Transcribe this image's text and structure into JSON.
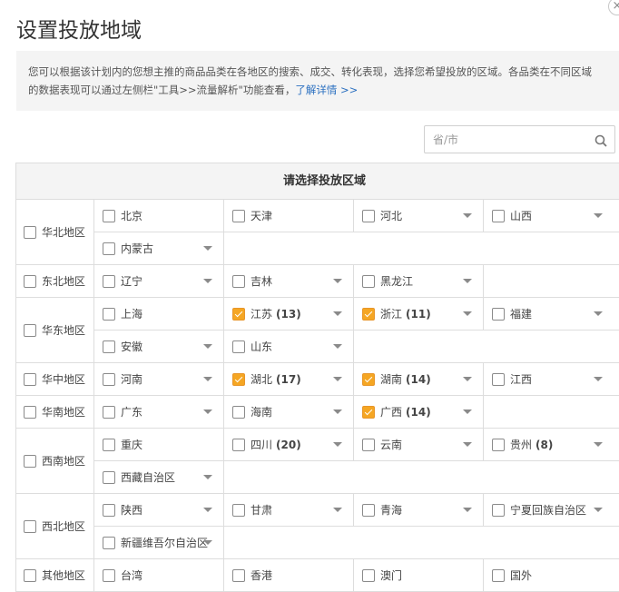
{
  "dialog": {
    "title": "设置投放地域",
    "close": "×",
    "notice_line1": "您可以根据该计划内的您想主推的商品品类在各地区的搜索、成交、转化表现，选择您希望投放的区域。各品类在不同区域",
    "notice_line2": "的数据表现可以通过左侧栏\"工具>>流量解析\"功能查看，",
    "notice_link": "了解详情 >>"
  },
  "search": {
    "placeholder": "省/市"
  },
  "table": {
    "header": "请选择投放区域",
    "regions": [
      {
        "name": "华北地区",
        "checked": false,
        "rows": [
          [
            {
              "name": "北京",
              "checked": false,
              "dropdown": false
            },
            {
              "name": "天津",
              "checked": false,
              "dropdown": false
            },
            {
              "name": "河北",
              "checked": false,
              "dropdown": true
            },
            {
              "name": "山西",
              "checked": false,
              "dropdown": true
            }
          ],
          [
            {
              "name": "内蒙古",
              "checked": false,
              "dropdown": true
            }
          ]
        ]
      },
      {
        "name": "东北地区",
        "checked": false,
        "rows": [
          [
            {
              "name": "辽宁",
              "checked": false,
              "dropdown": true
            },
            {
              "name": "吉林",
              "checked": false,
              "dropdown": true
            },
            {
              "name": "黑龙江",
              "checked": false,
              "dropdown": true
            }
          ]
        ]
      },
      {
        "name": "华东地区",
        "checked": false,
        "rows": [
          [
            {
              "name": "上海",
              "checked": false,
              "dropdown": false
            },
            {
              "name": "江苏",
              "count": "(13)",
              "checked": true,
              "dropdown": true
            },
            {
              "name": "浙江",
              "count": "(11)",
              "checked": true,
              "dropdown": true
            },
            {
              "name": "福建",
              "checked": false,
              "dropdown": true
            }
          ],
          [
            {
              "name": "安徽",
              "checked": false,
              "dropdown": true
            },
            {
              "name": "山东",
              "checked": false,
              "dropdown": true
            }
          ]
        ]
      },
      {
        "name": "华中地区",
        "checked": false,
        "rows": [
          [
            {
              "name": "河南",
              "checked": false,
              "dropdown": true
            },
            {
              "name": "湖北",
              "count": "(17)",
              "checked": true,
              "dropdown": true
            },
            {
              "name": "湖南",
              "count": "(14)",
              "checked": true,
              "dropdown": true
            },
            {
              "name": "江西",
              "checked": false,
              "dropdown": true
            }
          ]
        ]
      },
      {
        "name": "华南地区",
        "checked": false,
        "rows": [
          [
            {
              "name": "广东",
              "checked": false,
              "dropdown": true
            },
            {
              "name": "海南",
              "checked": false,
              "dropdown": true
            },
            {
              "name": "广西",
              "count": "(14)",
              "checked": true,
              "dropdown": true
            }
          ]
        ]
      },
      {
        "name": "西南地区",
        "checked": false,
        "rows": [
          [
            {
              "name": "重庆",
              "checked": false,
              "dropdown": false
            },
            {
              "name": "四川",
              "count": "(20)",
              "checked": false,
              "dropdown": true
            },
            {
              "name": "云南",
              "checked": false,
              "dropdown": true
            },
            {
              "name": "贵州",
              "count": "(8)",
              "checked": false,
              "dropdown": true
            }
          ],
          [
            {
              "name": "西藏自治区",
              "checked": false,
              "dropdown": true
            }
          ]
        ]
      },
      {
        "name": "西北地区",
        "checked": false,
        "rows": [
          [
            {
              "name": "陕西",
              "checked": false,
              "dropdown": true
            },
            {
              "name": "甘肃",
              "checked": false,
              "dropdown": true
            },
            {
              "name": "青海",
              "checked": false,
              "dropdown": true
            },
            {
              "name": "宁夏回族自治区",
              "checked": false,
              "dropdown": true
            }
          ],
          [
            {
              "name": "新疆维吾尔自治区",
              "checked": false,
              "dropdown": true
            }
          ]
        ]
      },
      {
        "name": "其他地区",
        "checked": false,
        "rows": [
          [
            {
              "name": "台湾",
              "checked": false,
              "dropdown": false
            },
            {
              "name": "香港",
              "checked": false,
              "dropdown": false
            },
            {
              "name": "澳门",
              "checked": false,
              "dropdown": false
            },
            {
              "name": "国外",
              "checked": false,
              "dropdown": false
            }
          ]
        ]
      }
    ]
  }
}
